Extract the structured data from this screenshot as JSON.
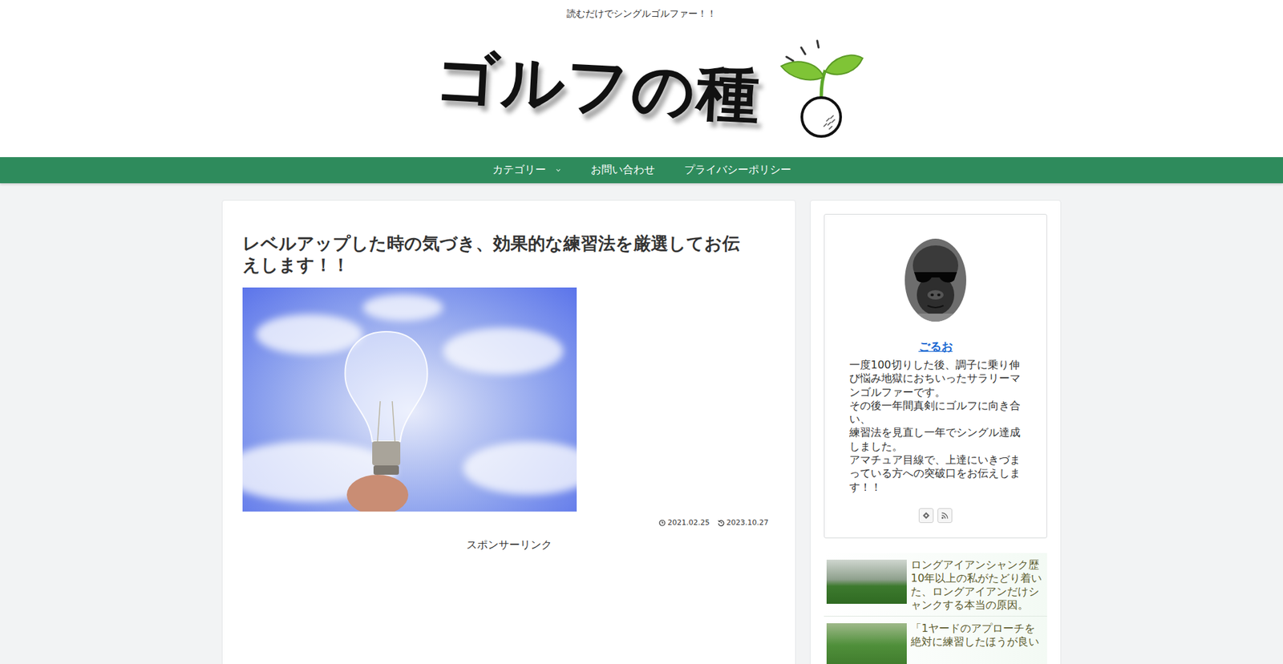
{
  "site": {
    "tagline": "読むだけでシングルゴルファー！！",
    "logo": "ゴルフの種"
  },
  "nav": [
    {
      "label": "カテゴリー",
      "dropdown": true
    },
    {
      "label": "お問い合わせ",
      "dropdown": false
    },
    {
      "label": "プライバシーポリシー",
      "dropdown": false
    }
  ],
  "article": {
    "title": "レベルアップした時の気づき、効果的な練習法を厳選してお伝えします！！",
    "date_published": "2021.02.25",
    "date_updated": "2023.10.27",
    "ad_label": "スポンサーリンク"
  },
  "profile": {
    "name": "ごるお",
    "bio": [
      "一度100切りした後、調子に乗り伸び悩み地獄におちいったサラリーマンゴルファーです。",
      "その後一年間真剣にゴルフに向き合い、",
      "練習法を見直し一年でシングル達成しました。",
      "アマチュア目線で、上達にいきづまっている方への突破口をお伝えします！！"
    ]
  },
  "popular": [
    {
      "title": "ロングアイアンシャンク歴10年以上の私がたどり着いた、ロングアイアンだけシャンクする本当の原因。"
    },
    {
      "title": "「1ヤードのアプローチを絶対に練習したほうが良い"
    }
  ]
}
